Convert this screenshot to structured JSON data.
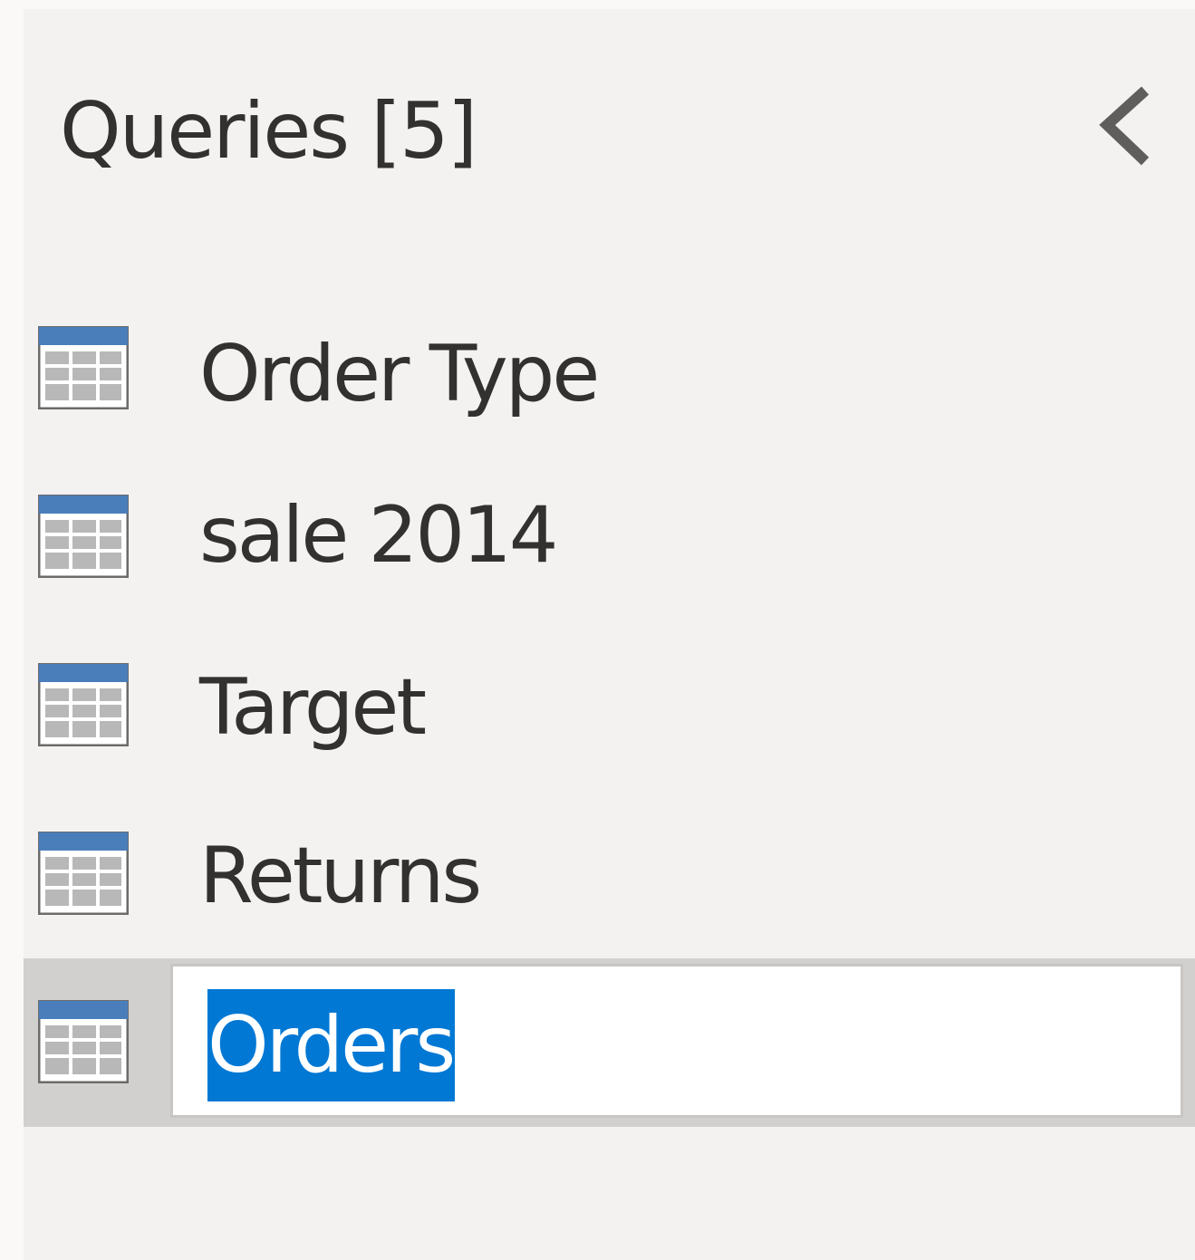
{
  "queries_pane": {
    "title": "Queries [5]",
    "collapse_icon": "chevron-left-icon",
    "items": [
      {
        "label": "Order Type",
        "icon": "table-icon",
        "selected": false
      },
      {
        "label": "sale 2014",
        "icon": "table-icon",
        "selected": false
      },
      {
        "label": "Target",
        "icon": "table-icon",
        "selected": false
      },
      {
        "label": "Returns",
        "icon": "table-icon",
        "selected": false
      },
      {
        "label": "Orders",
        "icon": "table-icon",
        "selected": true,
        "renaming": true
      }
    ]
  },
  "colors": {
    "pane_background": "#f3f2f1",
    "selected_row": "#d2d0ce",
    "text_selection": "#0078d4",
    "table_icon_header": "#4a7ebb",
    "table_icon_border": "#6b6b6b"
  }
}
